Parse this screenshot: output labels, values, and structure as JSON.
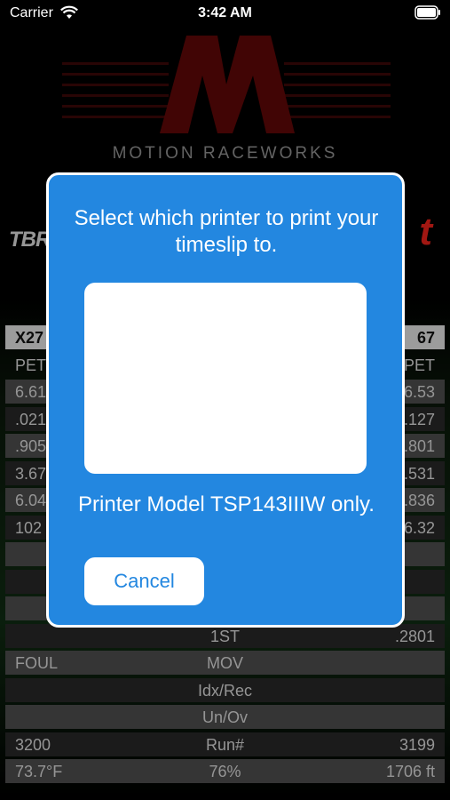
{
  "status_bar": {
    "carrier": "Carrier",
    "time": "3:42 AM"
  },
  "logo": {
    "text": "MOTION RACEWORKS",
    "accent_color": "#5a0808"
  },
  "brands": {
    "left": "TBR",
    "right": "t"
  },
  "table": {
    "rows": [
      {
        "l": "X27",
        "c": "",
        "r": "67",
        "style": "head"
      },
      {
        "l": "PET",
        "c": "",
        "r": "PET",
        "style": ""
      },
      {
        "l": "6.61",
        "c": "",
        "r": "6.53",
        "style": "alt"
      },
      {
        "l": ".021",
        "c": "",
        "r": ".127",
        "style": "dark"
      },
      {
        "l": ".905",
        "c": "",
        "r": ".801",
        "style": "alt"
      },
      {
        "l": "3.67",
        "c": "",
        "r": "3.531",
        "style": "dark"
      },
      {
        "l": "6.04",
        "c": "",
        "r": "5.836",
        "style": "alt"
      },
      {
        "l": "102",
        "c": "",
        "r": "6.32",
        "style": "dark"
      },
      {
        "l": "",
        "c": "",
        "r": "",
        "style": "alt"
      },
      {
        "l": "",
        "c": "",
        "r": "",
        "style": "dark"
      },
      {
        "l": "",
        "c": "",
        "r": "",
        "style": "alt"
      },
      {
        "l": "",
        "c": "1ST",
        "r": ".2801",
        "style": "dark"
      },
      {
        "l": "FOUL",
        "c": "MOV",
        "r": "",
        "style": "alt"
      },
      {
        "l": "",
        "c": "Idx/Rec",
        "r": "",
        "style": "dark"
      },
      {
        "l": "",
        "c": "Un/Ov",
        "r": "",
        "style": "alt"
      },
      {
        "l": "3200",
        "c": "Run#",
        "r": "3199",
        "style": "dark"
      },
      {
        "l": "73.7°F",
        "c": "76%",
        "r": "1706 ft",
        "style": "alt"
      }
    ]
  },
  "dialog": {
    "title": "Select which printer to print your timeslip to.",
    "note": "Printer Model TSP143IIIW only.",
    "cancel_label": "Cancel",
    "bg_color": "#2387e0"
  }
}
